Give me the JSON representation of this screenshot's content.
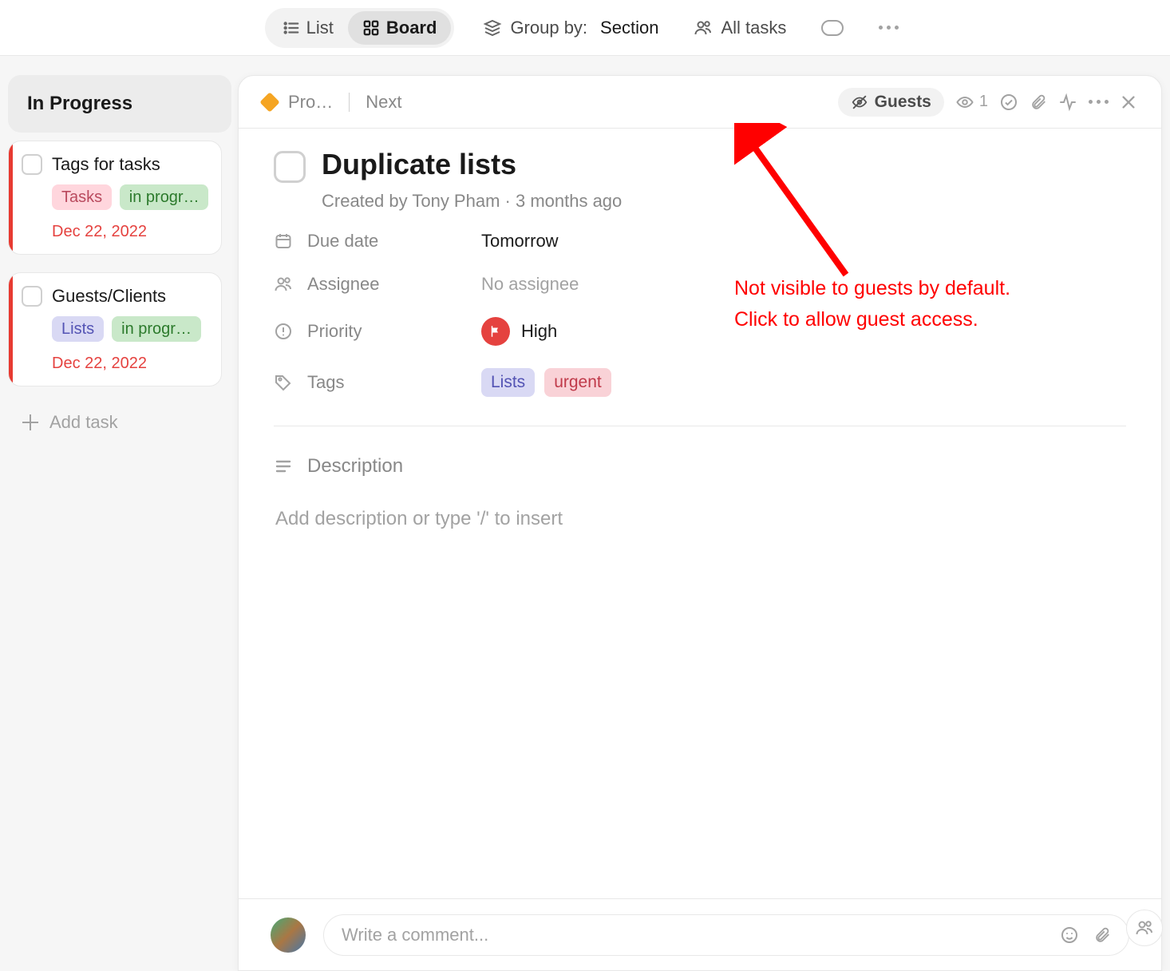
{
  "topbar": {
    "list_label": "List",
    "board_label": "Board",
    "group_by_label": "Group by:",
    "group_by_value": "Section",
    "all_tasks_label": "All tasks"
  },
  "column_header": "In Progress",
  "cards": [
    {
      "title": "Tags for tasks",
      "tags": [
        {
          "label": "Tasks",
          "variant": "pink"
        },
        {
          "label": "in progr…",
          "variant": "green"
        }
      ],
      "date": "Dec 22, 2022"
    },
    {
      "title": "Guests/Clients",
      "tags": [
        {
          "label": "Lists",
          "variant": "violet"
        },
        {
          "label": "in progr…",
          "variant": "green"
        }
      ],
      "date": "Dec 22, 2022"
    }
  ],
  "add_task_label": "Add task",
  "breadcrumb": {
    "project_short": "Pro…",
    "next_label": "Next"
  },
  "panel_head": {
    "guests_label": "Guests",
    "watch_count": "1"
  },
  "task": {
    "title": "Duplicate lists",
    "created_by_prefix": "Created by ",
    "author": "Tony Pham",
    "dot": " · ",
    "created_ago": "3 months ago",
    "due_label": "Due date",
    "due_value": "Tomorrow",
    "assignee_label": "Assignee",
    "assignee_value": "No assignee",
    "priority_label": "Priority",
    "priority_value": "High",
    "tags_label": "Tags",
    "tags": [
      {
        "label": "Lists",
        "variant": "violet"
      },
      {
        "label": "urgent",
        "variant": "red"
      }
    ],
    "description_label": "Description",
    "description_placeholder": "Add description or type '/' to insert"
  },
  "comment_placeholder": "Write a comment...",
  "annotation": {
    "line1": "Not visible to guests by default.",
    "line2": "Click to allow guest access."
  }
}
